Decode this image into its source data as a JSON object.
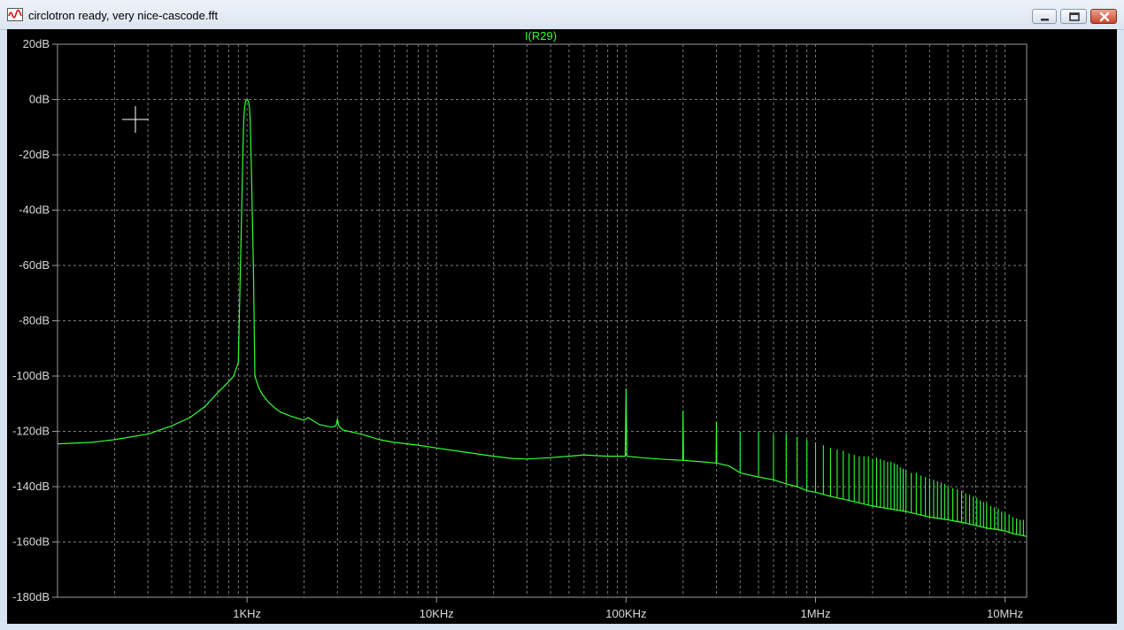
{
  "window": {
    "title": "circlotron ready, very nice-cascode.fft",
    "buttons": {
      "minimize": "minimize-icon",
      "maximize": "maximize-icon",
      "close": "close-icon"
    }
  },
  "colors": {
    "background": "#000000",
    "trace": "#33ff33",
    "grid": "#7a7a7a",
    "axis_text": "#d9d9d9",
    "frame": "#9a9a9a"
  },
  "chart_data": {
    "type": "line",
    "title": "I(R29)",
    "xscale": "log",
    "xlim": [
      100,
      13000000
    ],
    "ylim": [
      -180,
      20
    ],
    "x_ticks": [
      {
        "value": 1000,
        "label": "1KHz"
      },
      {
        "value": 10000,
        "label": "10KHz"
      },
      {
        "value": 100000,
        "label": "100KHz"
      },
      {
        "value": 1000000,
        "label": "1MHz"
      },
      {
        "value": 10000000,
        "label": "10MHz"
      }
    ],
    "y_ticks": [
      {
        "value": 20,
        "label": "20dB"
      },
      {
        "value": 0,
        "label": "0dB"
      },
      {
        "value": -20,
        "label": "-20dB"
      },
      {
        "value": -40,
        "label": "-40dB"
      },
      {
        "value": -60,
        "label": "-60dB"
      },
      {
        "value": -80,
        "label": "-80dB"
      },
      {
        "value": -100,
        "label": "-100dB"
      },
      {
        "value": -120,
        "label": "-120dB"
      },
      {
        "value": -140,
        "label": "-140dB"
      },
      {
        "value": -160,
        "label": "-160dB"
      },
      {
        "value": -180,
        "label": "-180dB"
      }
    ],
    "grid": true,
    "series": [
      {
        "name": "I(R29)",
        "color": "#33ff33",
        "x": [
          100,
          150,
          200,
          300,
          400,
          500,
          600,
          700,
          800,
          850,
          900,
          930,
          950,
          960,
          970,
          980,
          990,
          1000,
          1010,
          1020,
          1030,
          1040,
          1050,
          1080,
          1100,
          1150,
          1200,
          1300,
          1400,
          1500,
          1700,
          2000,
          2100,
          2400,
          2800,
          2950,
          3000,
          3050,
          3200,
          4000,
          5000,
          6000,
          8000,
          10000,
          14000,
          20000,
          25000,
          30000,
          40000,
          50000,
          60000,
          70000,
          80000,
          99000,
          100000,
          101000,
          120000,
          150000,
          199000,
          200000,
          201000,
          250000,
          299000,
          300000,
          301000,
          350000,
          400000,
          500000,
          600000,
          700000,
          800000,
          900000,
          1000000,
          1200000,
          1500000,
          2000000,
          3000000,
          4000000,
          5000000,
          6000000,
          7000000,
          8000000,
          9000000,
          10000000,
          11000000,
          12000000,
          13000000
        ],
        "y": [
          -124.5,
          -124,
          -123,
          -121,
          -118,
          -115,
          -111,
          -106,
          -102,
          -100,
          -95,
          -50,
          -20,
          -8,
          -3,
          -1,
          -0.3,
          0,
          -0.3,
          -1,
          -3,
          -8,
          -20,
          -60,
          -100,
          -104,
          -106.5,
          -109.5,
          -111.5,
          -113,
          -114.5,
          -116,
          -115,
          -117.5,
          -118.5,
          -118,
          -115.5,
          -118,
          -119.5,
          -121,
          -123,
          -124,
          -125,
          -126,
          -127.5,
          -129,
          -129.8,
          -130,
          -129.5,
          -129,
          -128.5,
          -128.8,
          -129,
          -129,
          -104.5,
          -129,
          -129.5,
          -130,
          -130.5,
          -112.5,
          -130.5,
          -131,
          -131.5,
          -116.5,
          -131.5,
          -132.5,
          -135,
          -136.5,
          -137.5,
          -139,
          -140,
          -141.5,
          -142,
          -143.5,
          -145,
          -147,
          -149,
          -151,
          -152,
          -153,
          -154,
          -155,
          -155.5,
          -156,
          -157,
          -157.5,
          -158
        ]
      },
      {
        "name": "spur-lines",
        "color": "#33ff33",
        "x": [
          400000,
          500000,
          600000,
          700000,
          800000,
          900000,
          1000000,
          1100000,
          1200000,
          1300000,
          1400000,
          1500000,
          1600000,
          1700000,
          1800000,
          1900000,
          2000000,
          2100000,
          2200000,
          2300000,
          2400000,
          2500000,
          2600000,
          2700000,
          2800000,
          2900000,
          3000000,
          3200000,
          3400000,
          3600000,
          3800000,
          4000000,
          4200000,
          4400000,
          4600000,
          4800000,
          5000000,
          5300000,
          5600000,
          5900000,
          6200000,
          6500000,
          6800000,
          7100000,
          7400000,
          7700000,
          8000000,
          8400000,
          8800000,
          9200000,
          9600000,
          10000000,
          10500000,
          11000000,
          11500000,
          12000000,
          12500000
        ],
        "y": [
          -120,
          -120,
          -121,
          -121,
          -122,
          -123,
          -124,
          -125,
          -126,
          -126.5,
          -127,
          -128,
          -128.5,
          -129,
          -129,
          -129,
          -130,
          -129.5,
          -130,
          -130.5,
          -131,
          -131,
          -131.5,
          -132,
          -133,
          -133.5,
          -134,
          -135,
          -135,
          -136,
          -136.5,
          -137,
          -137.5,
          -138,
          -138.5,
          -139,
          -140,
          -140.5,
          -141,
          -141.5,
          -142.5,
          -143,
          -143.5,
          -144,
          -145,
          -145.5,
          -146,
          -147,
          -147.5,
          -148,
          -149,
          -149.5,
          -150,
          -151,
          -151.5,
          -152,
          -152
        ]
      }
    ]
  }
}
